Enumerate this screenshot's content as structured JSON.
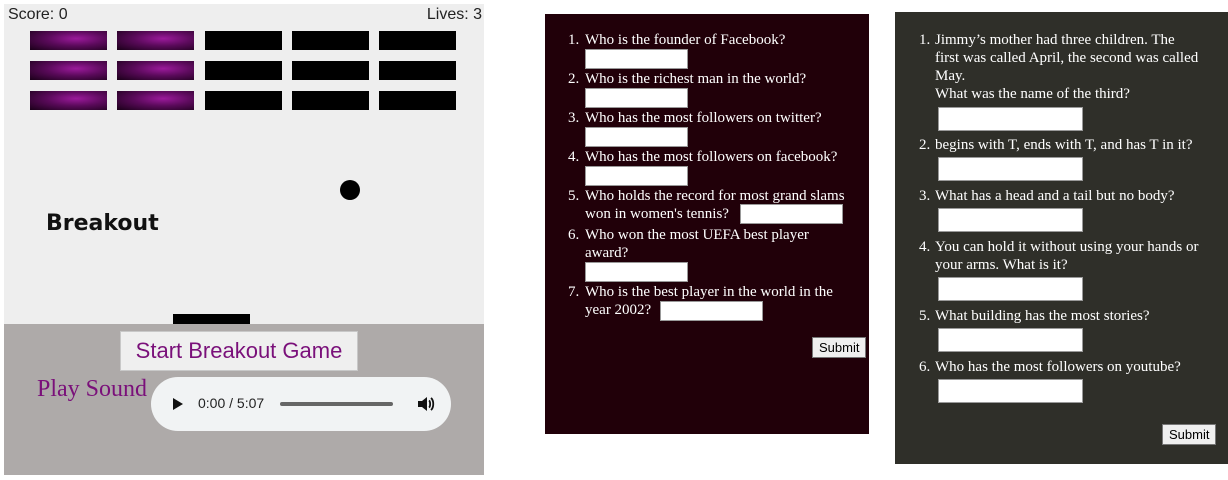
{
  "game": {
    "score_label": "Score: 0",
    "lives_label": "Lives: 3",
    "title": "Breakout",
    "start_button": "Start Breakout Game",
    "play_sound_label": "Play Sound",
    "audio_time": "0:00 / 5:07",
    "colors": {
      "brick": "#000000",
      "brick_glow": "#8b168b",
      "canvas_bg": "#eeeeee",
      "controls_bg": "#aeaaa9",
      "accent": "#7a107a"
    }
  },
  "quiz1": {
    "questions": [
      {
        "num": "1.",
        "text": "Who is the founder of Facebook?"
      },
      {
        "num": "2.",
        "text": "Who is the richest man in the world?"
      },
      {
        "num": "3.",
        "text": "Who has the most followers on twitter?"
      },
      {
        "num": "4.",
        "text": "Who has the most followers on facebook?"
      },
      {
        "num": "5.",
        "text_line1": "Who holds the record for most grand slams",
        "text_line2": "won in women's tennis?"
      },
      {
        "num": "6.",
        "text_line1": "Who won the most UEFA best player",
        "text_line2": "award?"
      },
      {
        "num": "7.",
        "text_line1": "Who is the best player in the world in the",
        "text_line2": "year 2002?"
      }
    ],
    "submit": "Submit"
  },
  "quiz2": {
    "questions": [
      {
        "num": "1.",
        "text_line1": "Jimmy’s mother had three children. The",
        "text_line2": "first was called April, the second was called",
        "text_line3": "May.",
        "text_line4": "What was the name of the third?"
      },
      {
        "num": "2.",
        "text": "begins with T, ends with T, and has T in it?"
      },
      {
        "num": "3.",
        "text": "What has a head and a tail but no body?"
      },
      {
        "num": "4.",
        "text_line1": "You can hold it without using your hands or",
        "text_line2": "your arms. What is it?"
      },
      {
        "num": "5.",
        "text": "What building has the most stories?"
      },
      {
        "num": "6.",
        "text": "Who has the most followers on youtube?"
      }
    ],
    "submit": "Submit"
  }
}
